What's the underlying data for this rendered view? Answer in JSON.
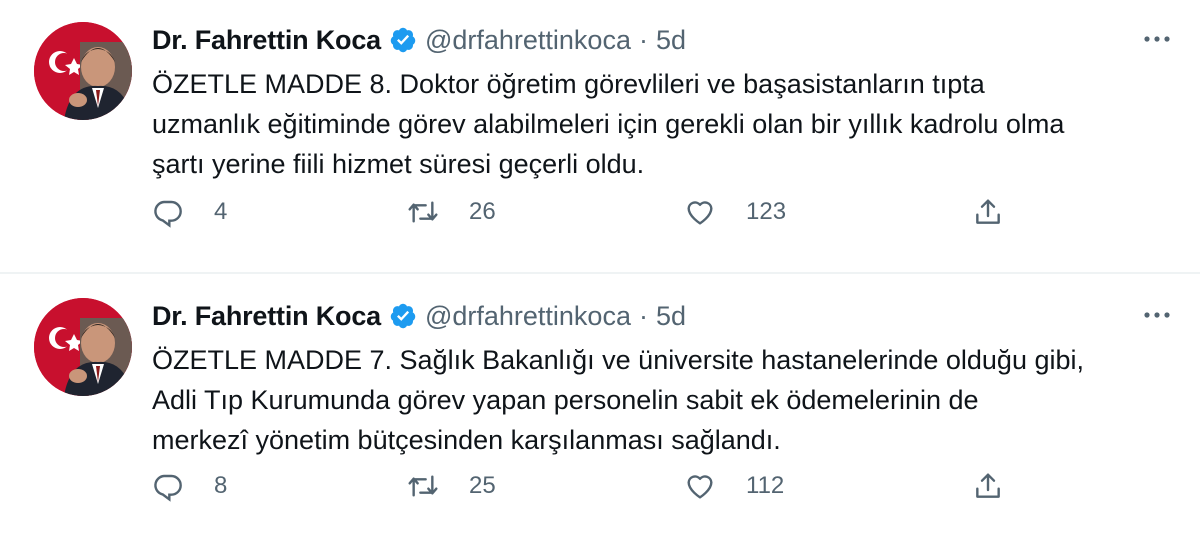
{
  "tweets": [
    {
      "author_name": "Dr. Fahrettin Koca",
      "handle": "@drfahrettinkoca",
      "separator": "·",
      "time": "5d",
      "text": "ÖZETLE MADDE 8. Doktor öğretim görevlileri ve başasistanların tıpta\nuzmanlık eğitiminde görev alabilmeleri için gerekli olan bir yıllık kadrolu olma\nşartı yerine fiili hizmet süresi geçerli oldu.",
      "replies": "4",
      "retweets": "26",
      "likes": "123"
    },
    {
      "author_name": "Dr. Fahrettin Koca",
      "handle": "@drfahrettinkoca",
      "separator": "·",
      "time": "5d",
      "text": "ÖZETLE MADDE 7. Sağlık Bakanlığı ve üniversite hastanelerinde olduğu gibi,\nAdli Tıp Kurumunda görev yapan personelin sabit ek ödemelerinin de\nmerkezî yönetim bütçesinden karşılanması sağlandı.",
      "replies": "8",
      "retweets": "25",
      "likes": "112"
    }
  ],
  "icons": {
    "verified": "verified-badge-icon",
    "more": "more-dots-icon",
    "reply": "reply-icon",
    "retweet": "retweet-icon",
    "like": "heart-icon",
    "share": "share-icon"
  },
  "colors": {
    "text": "#0f1419",
    "secondary": "#536471",
    "verified": "#1d9bf0",
    "divider": "#eff3f4",
    "avatar_bg": "#c8102e"
  }
}
